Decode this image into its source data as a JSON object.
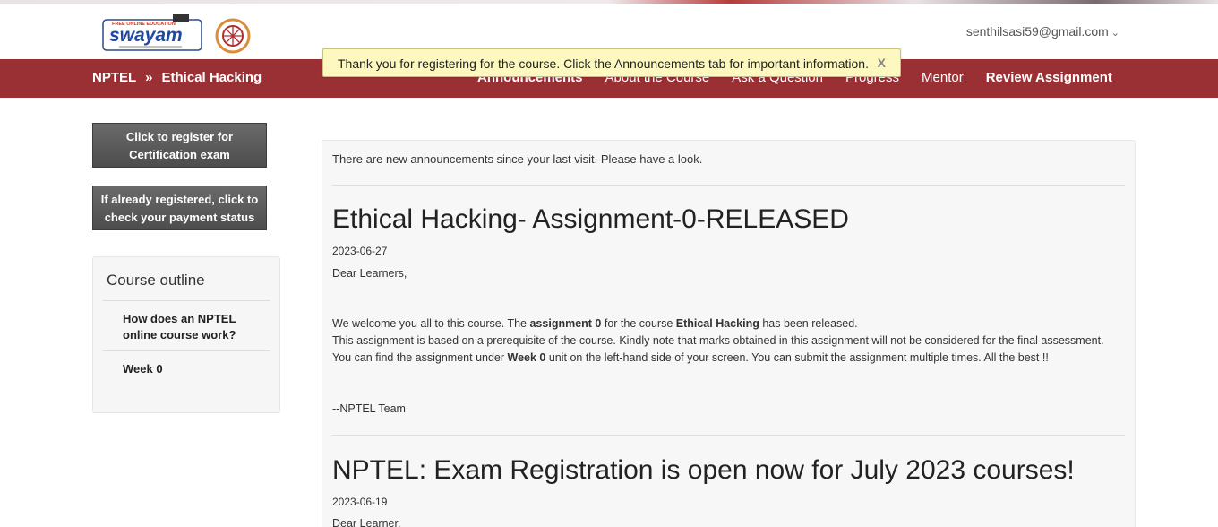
{
  "header": {
    "logo_text": "swayam",
    "logo_tagline": "FREE ONLINE EDUCATION",
    "user_email": "senthilsasi59@gmail.com"
  },
  "breadcrumb": {
    "root": "NPTEL",
    "separator": "»",
    "course": "Ethical Hacking"
  },
  "nav": {
    "items": [
      "Announcements",
      "About the Course",
      "Ask a Question",
      "Progress",
      "Mentor",
      "Review Assignment"
    ]
  },
  "toast": {
    "message": "Thank you for registering for the course. Click the Announcements tab for important information.",
    "close": "X"
  },
  "sidebar": {
    "register_button": "Click to register for Certification exam",
    "status_button": "If already registered, click to check your payment status",
    "outline_title": "Course outline",
    "outline_items": [
      "How does an NPTEL online course work?",
      "Week 0"
    ]
  },
  "main": {
    "notice": "There are new announcements since your last visit. Please have a look.",
    "announcements": [
      {
        "title": "Ethical Hacking- Assignment-0-RELEASED",
        "date": "2023-06-27",
        "greeting": "Dear Learners,",
        "line1_a": "We welcome you all to this course. The ",
        "line1_b": "assignment 0",
        "line1_c": " for the course ",
        "line1_d": "Ethical Hacking",
        "line1_e": " has been released.",
        "line2": "This assignment is based on a prerequisite of the course. Kindly note that marks obtained in this assignment will not be considered for the final assessment.",
        "line3_a": "You can find the assignment under ",
        "line3_b": "Week 0",
        "line3_c": " unit on the left-hand side of your screen. You can submit the assignment multiple times. All the best !!",
        "signature": "--NPTEL Team"
      },
      {
        "title": "NPTEL: Exam Registration is open now for July 2023 courses!",
        "date": "2023-06-19",
        "greeting": "Dear Learner,"
      }
    ]
  },
  "colors": {
    "navbar": "#9b3034",
    "toast_bg": "#fcf8c0",
    "button_bg": "#555555"
  }
}
